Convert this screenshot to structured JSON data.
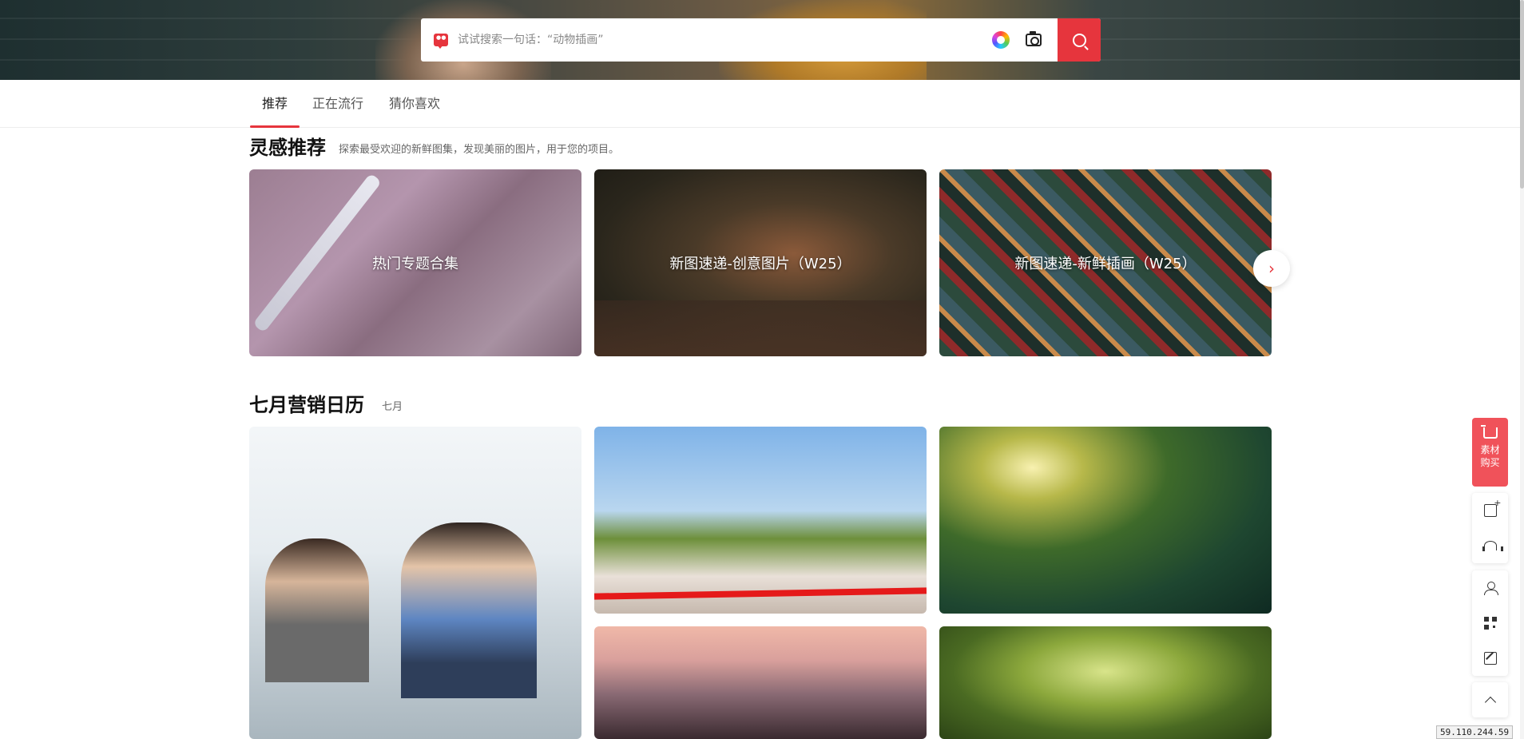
{
  "search": {
    "placeholder": "试试搜索一句话：“动物插画”"
  },
  "tabs": [
    {
      "label": "推荐",
      "active": true
    },
    {
      "label": "正在流行",
      "active": false
    },
    {
      "label": "猜你喜欢",
      "active": false
    }
  ],
  "inspiration": {
    "title": "灵感推荐",
    "subtitle": "探索最受欢迎的新鲜图集，发现美丽的图片，用于您的项目。",
    "cards": [
      {
        "label": "热门专题合集"
      },
      {
        "label": "新图速递-创意图片（W25）"
      },
      {
        "label": "新图速递-新鲜插画（W25）"
      }
    ],
    "next_icon": "chevron-right-icon"
  },
  "calendar": {
    "title": "七月营销日历",
    "subtitle": "七月"
  },
  "right_rail": {
    "purchase_label_line1": "素材",
    "purchase_label_line2": "购买",
    "icons": [
      "cart-icon",
      "image-upload-icon",
      "headset-icon",
      "user-icon",
      "qr-code-icon",
      "edit-icon",
      "back-to-top-icon"
    ]
  },
  "status": {
    "ip": "59.110.244.59"
  },
  "colors": {
    "accent": "#e6353d",
    "rail_accent": "#f0525a"
  }
}
